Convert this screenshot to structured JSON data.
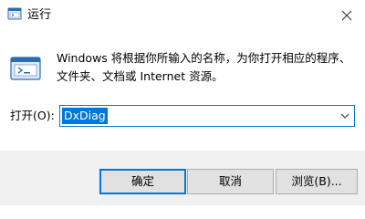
{
  "window": {
    "title": "运行",
    "app_icon": "run-app-icon",
    "close_icon": "close-icon"
  },
  "description": {
    "line1": "Windows 将根据你所输入的名称，为你打开相应的程序、",
    "line2": "文件夹、文档或 Internet 资源。",
    "icon": "run-dialog-icon"
  },
  "open_field": {
    "label": "打开(O):",
    "value": "DxDiag",
    "dropdown_icon": "chevron-down-icon"
  },
  "buttons": {
    "ok": "确定",
    "cancel": "取消",
    "browse": "浏览(B)..."
  },
  "colors": {
    "accent": "#0078d7",
    "footer_bg": "#f0f0f0",
    "button_bg": "#e1e1e1"
  }
}
